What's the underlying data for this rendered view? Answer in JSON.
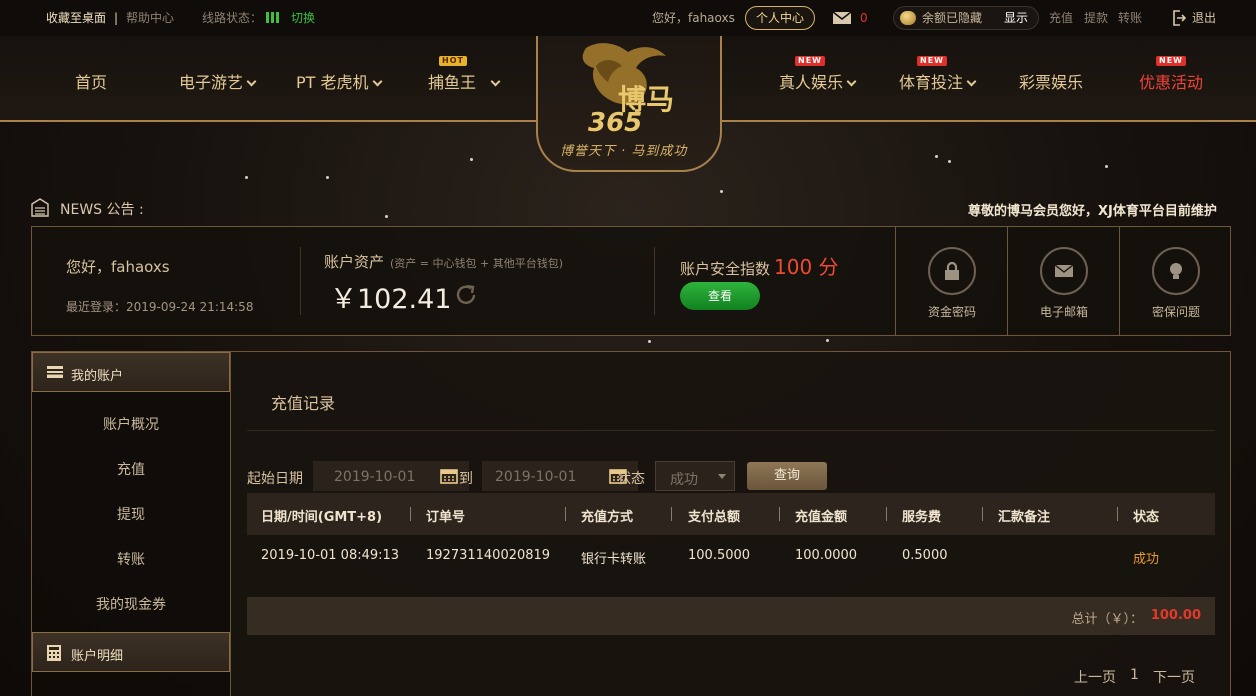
{
  "topbar": {
    "favorite": "收藏至桌面",
    "separator": "|",
    "help": "帮助中心",
    "line_status": "线路状态：",
    "switch": "切换",
    "hello": "您好，fahaoxs",
    "user_center": "个人中心",
    "mail_count": "0",
    "balance_hidden": "余额已隐藏",
    "show": "显示",
    "deposit": "充值",
    "withdraw": "提款",
    "transfer": "转账",
    "logout": "退出"
  },
  "nav": {
    "home": "首页",
    "egames": "电子游艺",
    "pt_slots": "PT 老虎机",
    "fishing": "捕鱼王",
    "live": "真人娱乐",
    "sports": "体育投注",
    "lottery": "彩票娱乐",
    "promotions": "优惠活动",
    "badge_hot": "HOT",
    "badge_new": "NEW"
  },
  "logo": {
    "brand_char": "博马",
    "number": "365",
    "slogan": "博誉天下 · 马到成功"
  },
  "news": {
    "label": "NEWS 公告 :",
    "marquee": "尊敬的博马会员您好，XJ体育平台目前维护"
  },
  "account_info": {
    "hello": "您好，fahaoxs",
    "last_login": "最近登录：2019-09-24 21:14:58",
    "asset_title": "账户资产",
    "asset_sub": "(资产 = 中心钱包 + 其他平台钱包)",
    "amount": "￥102.41",
    "security_title": "账户安全指数",
    "security_score": "100 分",
    "view_button": "查看",
    "fund_password": "资金密码",
    "email": "电子邮箱",
    "security_question": "密保问题"
  },
  "sidebar": {
    "my_account": "我的账户",
    "items": [
      "账户概况",
      "充值",
      "提现",
      "转账",
      "我的现金券"
    ],
    "account_details": "账户明细"
  },
  "main": {
    "title": "充值记录",
    "start_date_label": "起始日期",
    "start_date": "2019-10-01",
    "to_label": "到",
    "end_date": "2019-10-01",
    "status_label": "状态",
    "status_value": "成功",
    "query_button": "查询",
    "columns": [
      "日期/时间(GMT+8)",
      "订单号",
      "充值方式",
      "支付总额",
      "充值金额",
      "服务费",
      "汇款备注",
      "状态"
    ],
    "rows": [
      [
        "2019-10-01 08:49:13",
        "192731140020819",
        "银行卡转账",
        "100.5000",
        "100.0000",
        "0.5000",
        "",
        "成功"
      ]
    ],
    "total_label": "总计（￥）：",
    "total_value": "100.00",
    "prev_page": "上一页",
    "page": "1",
    "next_page": "下一页"
  }
}
